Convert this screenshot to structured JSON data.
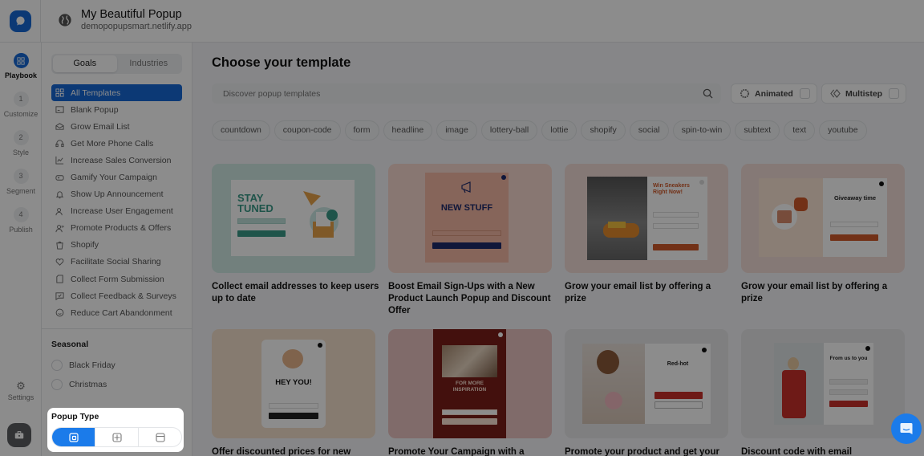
{
  "header": {
    "site_title": "My Beautiful Popup",
    "site_url": "demopopupsmart.netlify.app"
  },
  "rail": {
    "steps": [
      {
        "number": "",
        "label": "Playbook",
        "icon": "grid-icon",
        "active": true
      },
      {
        "number": "1",
        "label": "Customize"
      },
      {
        "number": "2",
        "label": "Style"
      },
      {
        "number": "3",
        "label": "Segment"
      },
      {
        "number": "4",
        "label": "Publish"
      }
    ],
    "settings_label": "Settings",
    "settings_icon": "⚙"
  },
  "filters": {
    "tabs": [
      "Goals",
      "Industries"
    ],
    "active_tab": "Goals",
    "goals": [
      {
        "label": "All Templates",
        "icon": "grid-icon",
        "active": true
      },
      {
        "label": "Blank Popup",
        "icon": "blank-popup-icon"
      },
      {
        "label": "Grow Email List",
        "icon": "envelope-icon"
      },
      {
        "label": "Get More Phone Calls",
        "icon": "headphones-icon"
      },
      {
        "label": "Increase Sales Conversion",
        "icon": "chart-icon"
      },
      {
        "label": "Gamify Your Campaign",
        "icon": "gamepad-icon"
      },
      {
        "label": "Show Up Announcement",
        "icon": "bell-icon"
      },
      {
        "label": "Increase User Engagement",
        "icon": "users-icon"
      },
      {
        "label": "Promote Products & Offers",
        "icon": "user-voice-icon"
      },
      {
        "label": "Shopify",
        "icon": "shopify-icon"
      },
      {
        "label": "Facilitate Social Sharing",
        "icon": "heart-icon"
      },
      {
        "label": "Collect Form Submission",
        "icon": "document-icon"
      },
      {
        "label": "Collect Feedback & Surveys",
        "icon": "feedback-icon"
      },
      {
        "label": "Reduce Cart Abandonment",
        "icon": "smile-icon"
      }
    ],
    "seasonal_title": "Seasonal",
    "seasonal": [
      "Black Friday",
      "Christmas"
    ]
  },
  "main": {
    "title": "Choose your template",
    "search_placeholder": "Discover popup templates",
    "animated_label": "Animated",
    "multistep_label": "Multistep",
    "tags": [
      "countdown",
      "coupon-code",
      "form",
      "headline",
      "image",
      "lottery-ball",
      "lottie",
      "shopify",
      "social",
      "spin-to-win",
      "subtext",
      "text",
      "youtube"
    ],
    "templates": [
      {
        "title": "Collect email addresses to keep users up to date",
        "preview_heading": "STAY TUNED",
        "bg": "#cfe9e4"
      },
      {
        "title": "Boost Email Sign-Ups with a New Product Launch Popup and Discount Offer",
        "preview_heading": "NEW STUFF",
        "bg": "#f7d9cf"
      },
      {
        "title": "Grow your email list by offering a prize",
        "preview_heading": "Win Sneakers Right Now!",
        "bg": "#f2dcd8"
      },
      {
        "title": "Grow your email list by offering a prize",
        "preview_heading": "Giveaway time",
        "bg": "#f2dcd8"
      },
      {
        "title": "Offer discounted prices for new",
        "preview_heading": "HEY YOU!",
        "bg": "#f5e1cd"
      },
      {
        "title": "Promote Your Campaign with a",
        "preview_heading": "FOR MORE INSPIRATION",
        "bg": "#e9c4c2"
      },
      {
        "title": "Promote your product and get your",
        "preview_heading": "Red-hot",
        "bg": "#e7e8ea"
      },
      {
        "title": "Discount code with email",
        "preview_heading": "From us to you",
        "bg": "#e7e8ea"
      }
    ]
  },
  "popup_type": {
    "title": "Popup Type",
    "options": [
      {
        "name": "modal",
        "active": true
      },
      {
        "name": "full-screen",
        "active": false
      },
      {
        "name": "banner",
        "active": false
      }
    ]
  },
  "colors": {
    "accent": "#1769d6",
    "overlay": "rgba(0,0,0,0.45)"
  }
}
